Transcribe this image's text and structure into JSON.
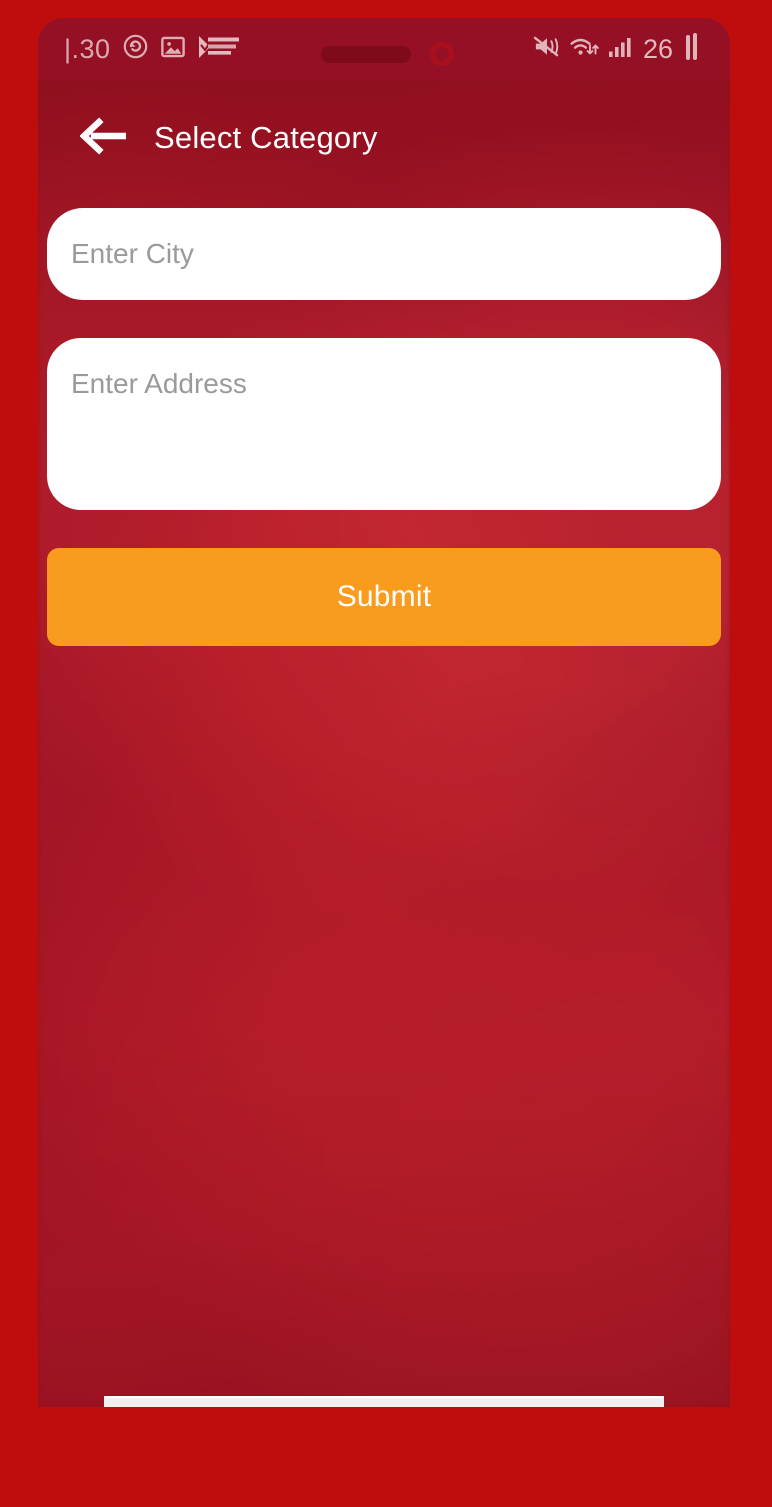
{
  "theme": {
    "backdrop_red": "#bf0d0d",
    "screen_red": "#991224",
    "statusbar_red": "#951024",
    "accent_orange": "#f99b1c",
    "field_white": "#ffffff",
    "placeholder_gray": "#9a9a9a",
    "title_white": "#ffffff"
  },
  "status_bar": {
    "clock": "|.30",
    "left_icons": [
      {
        "name": "sync-icon",
        "label": "sync"
      },
      {
        "name": "image-icon",
        "label": "screenshot"
      },
      {
        "name": "check-flag-icon",
        "label": "task complete"
      }
    ],
    "right": {
      "mute_icon": "volume-mute-icon",
      "wifi_icon": "wifi-transfer-icon",
      "signal_icon": "cellular-signal-icon",
      "battery_level": "26",
      "battery_icon": "battery-icon"
    }
  },
  "app_bar": {
    "back_icon": "arrow-left-icon",
    "title": "Select Category"
  },
  "form": {
    "city": {
      "placeholder": "Enter City",
      "value": ""
    },
    "address": {
      "placeholder": "Enter Address",
      "value": ""
    },
    "submit_label": "Submit"
  }
}
